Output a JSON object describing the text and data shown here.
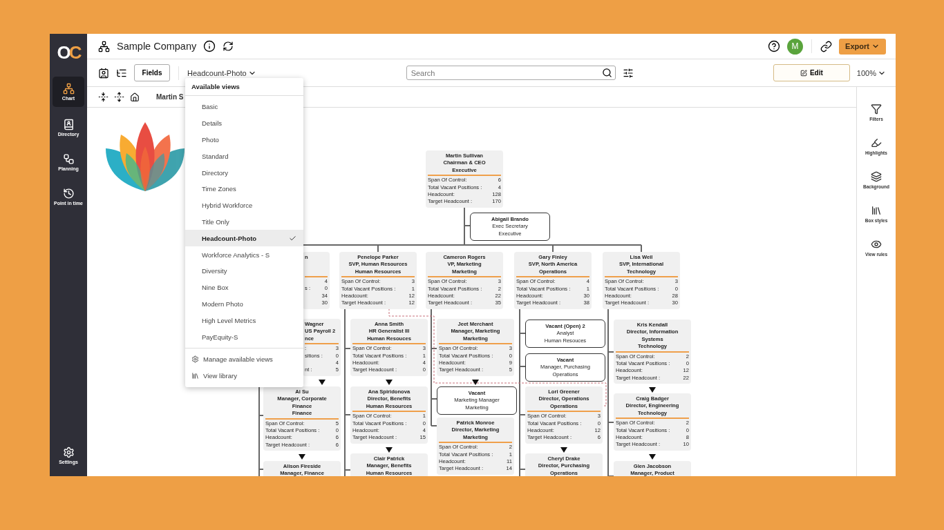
{
  "sidebar": {
    "logo": "OC",
    "items": [
      {
        "label": "Chart",
        "selected": true
      },
      {
        "label": "Directory",
        "selected": false
      },
      {
        "label": "Planning",
        "selected": false
      },
      {
        "label": "Point in time",
        "selected": false
      }
    ],
    "settings": "Settings"
  },
  "header": {
    "title": "Sample Company",
    "avatar": "M",
    "export": "Export"
  },
  "toolbar": {
    "fields": "Fields",
    "view": "Headcount-Photo",
    "search": {
      "placeholder": "Search"
    },
    "edit": "Edit",
    "zoom": "100%"
  },
  "breadcrumb": "Martin S",
  "views_menu": {
    "title": "Available views",
    "items": [
      {
        "label": "Basic",
        "selected": false
      },
      {
        "label": "Details",
        "selected": false
      },
      {
        "label": "Photo",
        "selected": false
      },
      {
        "label": "Standard",
        "selected": false
      },
      {
        "label": "Directory",
        "selected": false
      },
      {
        "label": "Time Zones",
        "selected": false
      },
      {
        "label": "Hybrid Workforce",
        "selected": false
      },
      {
        "label": "Title Only",
        "selected": false
      },
      {
        "label": "Headcount-Photo",
        "selected": true
      },
      {
        "label": "Workforce Analytics - S",
        "selected": false
      },
      {
        "label": "Diversity",
        "selected": false
      },
      {
        "label": "Nine Box",
        "selected": false
      },
      {
        "label": "Modern Photo",
        "selected": false
      },
      {
        "label": "High Level Metrics",
        "selected": false
      },
      {
        "label": "PayEquity-S",
        "selected": false
      }
    ],
    "actions": [
      "Manage available views",
      "View library"
    ]
  },
  "right_panel": [
    "Filters",
    "Highlights",
    "Background",
    "Box styles",
    "View rules"
  ],
  "chart": {
    "nodes": [
      {
        "kind": "metrics",
        "collapsed": false,
        "lines": [
          "Martin Sullivan",
          "Chairman & CEO",
          "Executive"
        ],
        "metrics": [
          {
            "label": "Span Of Control:",
            "value": "6"
          },
          {
            "label": "Total Vacant Positions :",
            "value": "4"
          },
          {
            "label": "Headcount:",
            "value": "128"
          },
          {
            "label": "Target Headcount :",
            "value": "170"
          }
        ]
      },
      {
        "kind": "plain",
        "collapsed": false,
        "lines": [
          "Abigail Brando",
          "Exec Secretary",
          "Executive"
        ]
      },
      {
        "kind": "partial",
        "collapsed": false,
        "lines": [
          "n"
        ],
        "metrics": [
          {
            "value": "4"
          },
          {
            "label": "s :",
            "value": "0"
          },
          {
            "value": "34"
          },
          {
            "value": "30"
          }
        ]
      },
      {
        "kind": "metrics",
        "collapsed": false,
        "lines": [
          "Penelope Parker",
          "SVP, Human Resources",
          "Human Resources"
        ],
        "metrics": [
          {
            "label": "Span Of Control:",
            "value": "3"
          },
          {
            "label": "Total Vacant Positions :",
            "value": "1"
          },
          {
            "label": "Headcount:",
            "value": "12"
          },
          {
            "label": "Target Headcount :",
            "value": "12"
          }
        ]
      },
      {
        "kind": "metrics",
        "collapsed": false,
        "lines": [
          "Cameron Rogers",
          "VP, Marketing",
          "Marketing"
        ],
        "metrics": [
          {
            "label": "Span Of Control:",
            "value": "3"
          },
          {
            "label": "Total Vacant Positions :",
            "value": "2"
          },
          {
            "label": "Headcount:",
            "value": "22"
          },
          {
            "label": "Target Headcount :",
            "value": "35"
          }
        ]
      },
      {
        "kind": "metrics",
        "collapsed": false,
        "lines": [
          "Gary Finley",
          "SVP, North America",
          "Operations"
        ],
        "metrics": [
          {
            "label": "Span Of Control:",
            "value": "4"
          },
          {
            "label": "Total Vacant Positions :",
            "value": "1"
          },
          {
            "label": "Headcount:",
            "value": "30"
          },
          {
            "label": "Target Headcount :",
            "value": "38"
          }
        ]
      },
      {
        "kind": "metrics",
        "collapsed": false,
        "lines": [
          "Lisa Weil",
          "SVP, International",
          "Technology"
        ],
        "metrics": [
          {
            "label": "Span Of Control:",
            "value": "3"
          },
          {
            "label": "Total Vacant Positions :",
            "value": "0"
          },
          {
            "label": "Headcount:",
            "value": "28"
          },
          {
            "label": "Target Headcount :",
            "value": "30"
          }
        ]
      },
      {
        "kind": "partial",
        "collapsed": true,
        "lines": [
          "Wagner",
          "US Payroll 2",
          "nce"
        ],
        "metrics": [
          {
            "label": ":",
            "value": "3"
          },
          {
            "label": "sitions :",
            "value": "0"
          },
          {
            "value": "4"
          },
          {
            "label": "nt :",
            "value": "5"
          }
        ]
      },
      {
        "kind": "metrics",
        "collapsed": true,
        "lines": [
          "Anna Smith",
          "HR Generalist III",
          "Human Resouces"
        ],
        "metrics": [
          {
            "label": "Span Of Control:",
            "value": "3"
          },
          {
            "label": "Total Vacant Positions :",
            "value": "1"
          },
          {
            "label": "Headcount:",
            "value": "4"
          },
          {
            "label": "Target Headcount :",
            "value": "0"
          }
        ]
      },
      {
        "kind": "metrics",
        "collapsed": true,
        "lines": [
          "Jeet Merchant",
          "Manager, Marketing",
          "Marketing"
        ],
        "metrics": [
          {
            "label": "Span Of Control:",
            "value": "3"
          },
          {
            "label": "Total Vacant Positions :",
            "value": "0"
          },
          {
            "label": "Headcount:",
            "value": "9"
          },
          {
            "label": "Target Headcount :",
            "value": "5"
          }
        ]
      },
      {
        "kind": "plain",
        "collapsed": false,
        "lines": [
          "Vacant (Open) 2",
          "Analyst",
          "Human Resouces"
        ]
      },
      {
        "kind": "plain",
        "collapsed": false,
        "lines": [
          "Vacant",
          "Manager, Purchasing",
          "Operations"
        ]
      },
      {
        "kind": "metrics",
        "collapsed": true,
        "lines": [
          "Kris Kendall",
          "Director, Information",
          "Systems",
          "Technology"
        ],
        "metrics": [
          {
            "label": "Span Of Control:",
            "value": "2"
          },
          {
            "label": "Total Vacant Positions :",
            "value": "0"
          },
          {
            "label": "Headcount:",
            "value": "12"
          },
          {
            "label": "Target Headcount :",
            "value": "22"
          }
        ]
      },
      {
        "kind": "metrics",
        "collapsed": true,
        "lines": [
          "Ai Su",
          "Manager, Corporate",
          "Finance",
          "Finance"
        ],
        "metrics": [
          {
            "label": "Span Of Control:",
            "value": "5"
          },
          {
            "label": "Total Vacant Positions :",
            "value": "0"
          },
          {
            "label": "Headcount:",
            "value": "6"
          },
          {
            "label": "Target Headcount :",
            "value": "6"
          }
        ]
      },
      {
        "kind": "metrics",
        "collapsed": true,
        "lines": [
          "Ana Spiridonova",
          "Director, Benefits",
          "Human Resources"
        ],
        "metrics": [
          {
            "label": "Span Of Control:",
            "value": "1"
          },
          {
            "label": "Total Vacant Positions :",
            "value": "0"
          },
          {
            "label": "Headcount:",
            "value": "4"
          },
          {
            "label": "Target Headcount :",
            "value": "15"
          }
        ]
      },
      {
        "kind": "plain",
        "collapsed": false,
        "lines": [
          "Vacant",
          "Marketing Manager",
          "Marketing"
        ]
      },
      {
        "kind": "metrics",
        "collapsed": true,
        "lines": [
          "Lori Greener",
          "Director, Operations",
          "Operations"
        ],
        "metrics": [
          {
            "label": "Span Of Control:",
            "value": "3"
          },
          {
            "label": "Total Vacant Positions :",
            "value": "0"
          },
          {
            "label": "Headcount:",
            "value": "12"
          },
          {
            "label": "Target Headcount :",
            "value": "6"
          }
        ]
      },
      {
        "kind": "metrics",
        "collapsed": true,
        "lines": [
          "Craig Badger",
          "Director, Engineering",
          "Technology"
        ],
        "metrics": [
          {
            "label": "Span Of Control:",
            "value": "2"
          },
          {
            "label": "Total Vacant Positions :",
            "value": "0"
          },
          {
            "label": "Headcount:",
            "value": "8"
          },
          {
            "label": "Target Headcount :",
            "value": "10"
          }
        ]
      },
      {
        "kind": "metrics",
        "collapsed": false,
        "lines": [
          "Patrick Monroe",
          "Director, Marketing",
          "Marketing"
        ],
        "metrics": [
          {
            "label": "Span Of Control:",
            "value": "2"
          },
          {
            "label": "Total Vacant Positions :",
            "value": "1"
          },
          {
            "label": "Headcount:",
            "value": "11"
          },
          {
            "label": "Target Headcount :",
            "value": "14"
          }
        ]
      },
      {
        "kind": "metrics",
        "collapsed": false,
        "lines": [
          "Alison Fireside",
          "Manager, Finance"
        ]
      },
      {
        "kind": "metrics",
        "collapsed": false,
        "lines": [
          "Clair Patrick",
          "Manager, Benefits",
          "Human Resources"
        ]
      },
      {
        "kind": "metrics",
        "collapsed": false,
        "lines": [
          "Cheryl Drake",
          "Director, Purchasing",
          "Operations"
        ]
      },
      {
        "kind": "metrics",
        "collapsed": false,
        "lines": [
          "Glen Jacobson",
          "Manager, Product"
        ]
      }
    ]
  }
}
